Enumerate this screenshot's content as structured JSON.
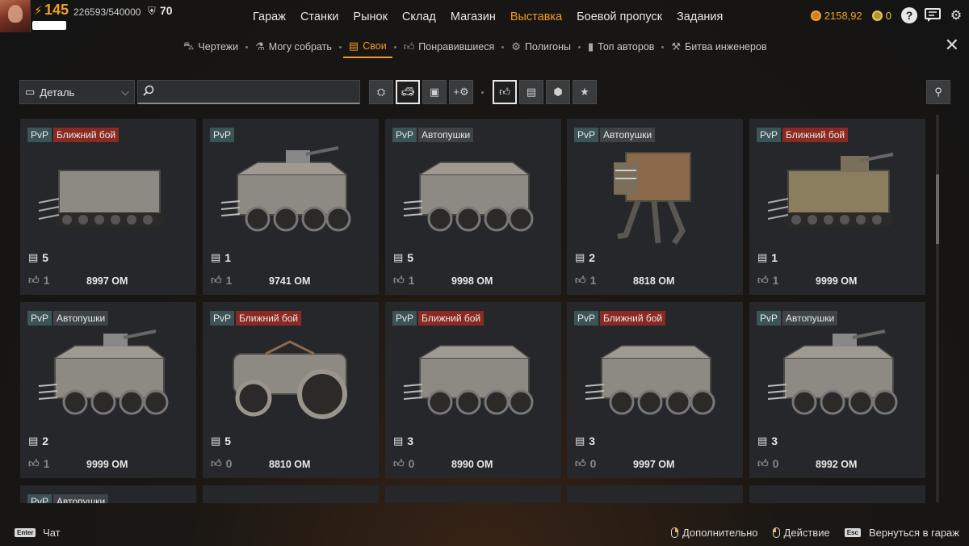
{
  "player": {
    "level": "145",
    "xp": "226593/540000",
    "rank": "70"
  },
  "nav": [
    {
      "label": "Гараж",
      "active": false
    },
    {
      "label": "Станки",
      "active": false
    },
    {
      "label": "Рынок",
      "active": false
    },
    {
      "label": "Склад",
      "active": false
    },
    {
      "label": "Магазин",
      "active": false
    },
    {
      "label": "Выставка",
      "active": true
    },
    {
      "label": "Боевой пропуск",
      "active": false
    },
    {
      "label": "Задания",
      "active": false
    }
  ],
  "wallet": {
    "coins": "2158,92",
    "badges": "0"
  },
  "subnav": [
    {
      "label": "Чертежи",
      "icon": "car-outline-icon",
      "active": false
    },
    {
      "label": "Могу собрать",
      "icon": "wrench-person-icon",
      "active": false
    },
    {
      "label": "Свои",
      "icon": "save-disk-icon",
      "active": true
    },
    {
      "label": "Понравившиеся",
      "icon": "thumbs-up-icon",
      "active": false
    },
    {
      "label": "Полигоны",
      "icon": "bug-icon",
      "active": false
    },
    {
      "label": "Топ авторов",
      "icon": "bar-chart-icon",
      "active": false
    },
    {
      "label": "Битва инженеров",
      "icon": "anvil-icon",
      "active": false
    }
  ],
  "filter": {
    "category": "Деталь",
    "search_value": "",
    "search_placeholder": ""
  },
  "colors": {
    "accent": "#f29a25",
    "tag_pvp": "#3b5458",
    "tag_melee": "#8a2a23",
    "tag_auto": "#3e4347"
  },
  "tag_labels": {
    "pvp": "PvP",
    "melee": "Ближний бой",
    "auto": "Автопушки"
  },
  "cards": [
    {
      "mode": "melee",
      "vehicle": "tracked-armored",
      "saves": "5",
      "likes": "1",
      "price": "8997 ОМ"
    },
    {
      "mode": "",
      "vehicle": "wheeled-turret",
      "saves": "1",
      "likes": "1",
      "price": "9741 ОМ"
    },
    {
      "mode": "auto",
      "vehicle": "wheeled-armored",
      "saves": "5",
      "likes": "1",
      "price": "9998 ОМ"
    },
    {
      "mode": "auto",
      "vehicle": "walker",
      "saves": "2",
      "likes": "1",
      "price": "8818 ОМ"
    },
    {
      "mode": "melee",
      "vehicle": "tracked-tank",
      "saves": "1",
      "likes": "1",
      "price": "9999 ОМ"
    },
    {
      "mode": "auto",
      "vehicle": "wheeled-turret",
      "saves": "2",
      "likes": "1",
      "price": "9999 ОМ"
    },
    {
      "mode": "melee",
      "vehicle": "drum-roller",
      "saves": "5",
      "likes": "0",
      "price": "8810 ОМ"
    },
    {
      "mode": "melee",
      "vehicle": "wheeled-armored",
      "saves": "3",
      "likes": "0",
      "price": "8990 ОМ"
    },
    {
      "mode": "melee",
      "vehicle": "wheeled-armored",
      "saves": "3",
      "likes": "0",
      "price": "9997 ОМ"
    },
    {
      "mode": "auto",
      "vehicle": "wheeled-turret",
      "saves": "3",
      "likes": "0",
      "price": "8992 ОМ"
    }
  ],
  "partial_row": [
    {
      "mode": "auto"
    },
    {
      "mode": ""
    },
    {
      "mode": ""
    },
    {
      "mode": ""
    },
    {
      "mode": ""
    }
  ],
  "bottom": {
    "chat_key": "Enter",
    "chat_label": "Чат",
    "hints": [
      {
        "label": "Дополнительно",
        "icon": "mouse-right-icon"
      },
      {
        "label": "Действие",
        "icon": "mouse-left-icon"
      },
      {
        "label": "Вернуться в гараж",
        "key": "Esc"
      }
    ]
  }
}
